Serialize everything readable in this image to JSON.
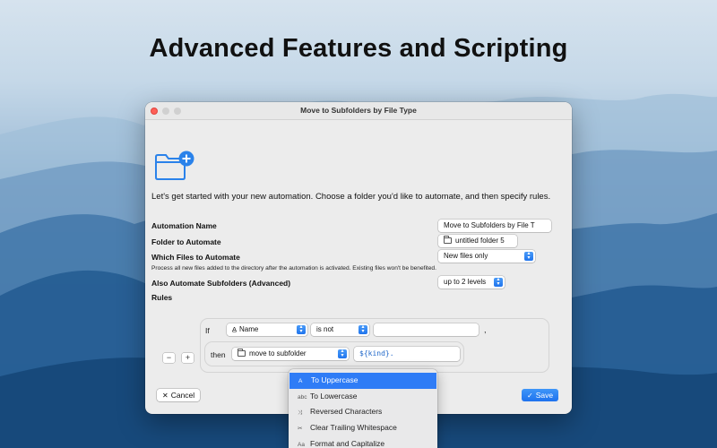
{
  "headline": "Advanced Features and Scripting",
  "window": {
    "title": "Move to Subfolders by File Type",
    "intro": "Let's get started with your new automation. Choose a folder you'd like to automate, and then specify rules.",
    "automation_name_label": "Automation Name",
    "automation_name_value": "Move to Subfolders by File T",
    "folder_label": "Folder to Automate",
    "folder_value": "untitled folder 5",
    "which_files_label": "Which Files to Automate",
    "which_files_value": "New files only",
    "which_files_hint": "Process all new files added to the directory after the automation is activated. Existing files won't be benefited.",
    "subfolders_label": "Also Automate Subfolders (Advanced)",
    "subfolders_value": "up to 2 levels",
    "rules_label": "Rules",
    "rule": {
      "if_label": "If",
      "field_icon": "A̲",
      "field_value": "Name",
      "operator_value": "is not",
      "comparison_value": "",
      "trailing_comma": ",",
      "then_label": "then",
      "action_value": "move to subfolder",
      "token_prefix": "${",
      "token_name": "kind",
      "token_suffix": "}."
    },
    "remove_button": "−",
    "add_button": "+",
    "cancel_button": "Cancel",
    "save_button": "Save",
    "cancel_icon": "✕",
    "save_icon": "✓",
    "accent_color": "#2f7cf6"
  },
  "menu": {
    "items": [
      {
        "icon": "A",
        "label": "To Uppercase",
        "active": true
      },
      {
        "icon": "abc",
        "label": "To Lowercase"
      },
      {
        "icon": "⤨",
        "label": "Reversed Characters"
      },
      {
        "icon": "✂",
        "label": "Clear Trailing Whitespace"
      },
      {
        "icon": "Aa",
        "label": "Format and Capitalize"
      }
    ]
  }
}
